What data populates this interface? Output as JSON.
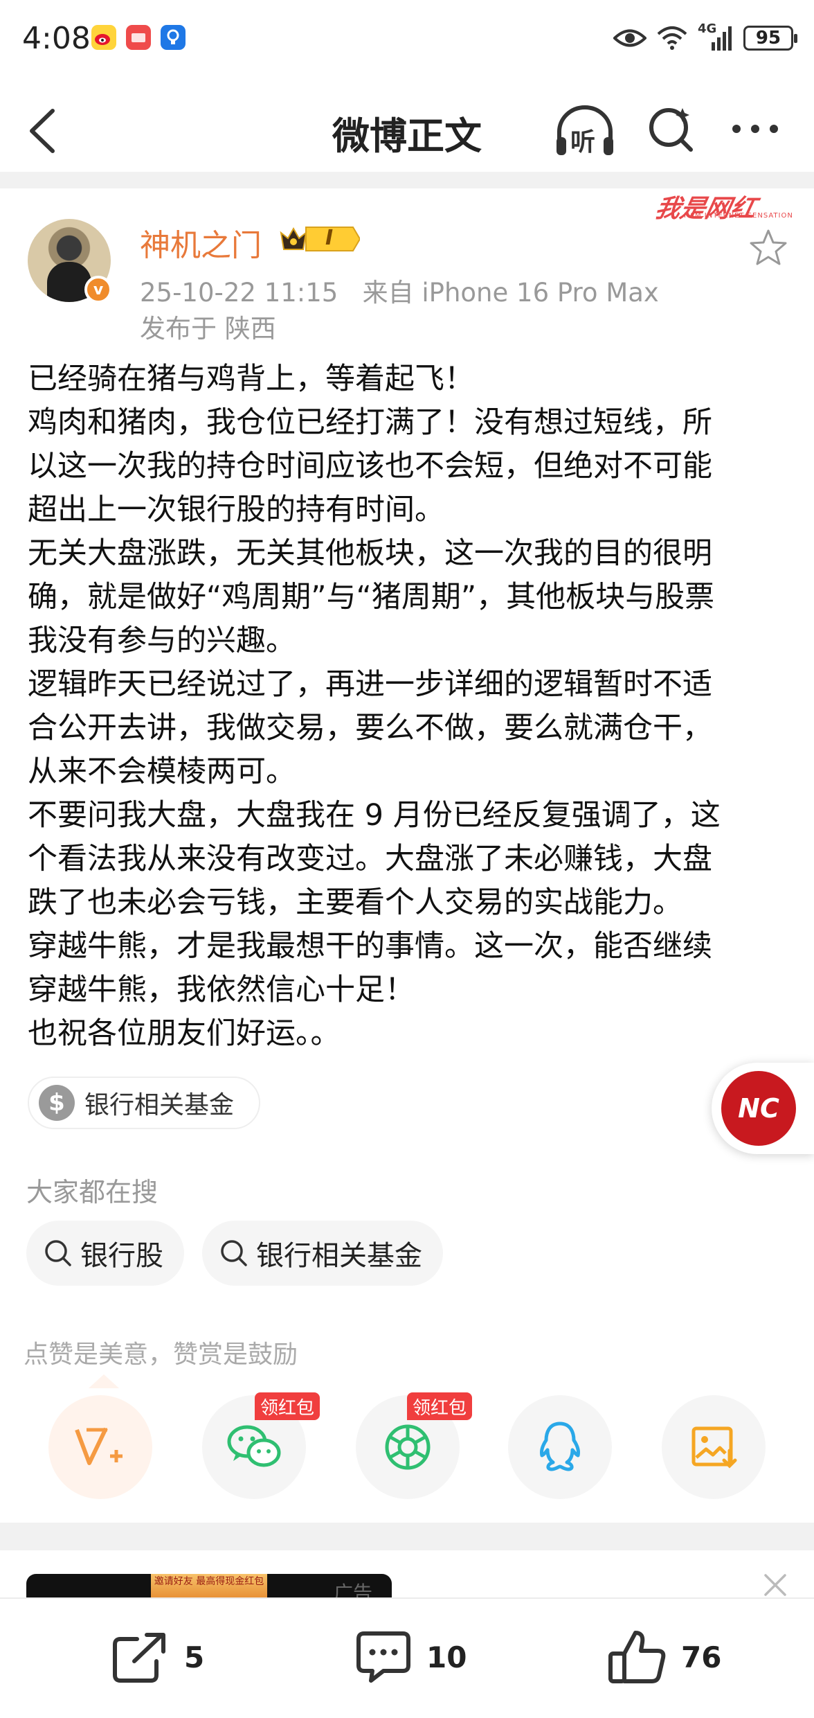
{
  "status_bar": {
    "time": "4:08",
    "network": "4G",
    "battery": "95",
    "icons": [
      "weibo-app-icon",
      "huawei-app-icon",
      "lightbulb-app-icon",
      "eye-icon",
      "wifi-icon",
      "signal-icon",
      "battery-icon"
    ]
  },
  "nav": {
    "title": "微博正文",
    "listen_label": "听",
    "icons": [
      "back-icon",
      "listen-icon",
      "search-icon",
      "more-icon"
    ]
  },
  "post": {
    "author": "神机之门",
    "vip_level": "I",
    "avatar_badge": "v",
    "meta": "25-10-22 11:15   来自 iPhone 16 Pro Max",
    "location": "发布于 陕西",
    "watermark": "我是网红",
    "watermark_sub": "I AM INTERNET SENSATION",
    "lines": [
      "已经骑在猪与鸡背上，等着起飞！",
      "鸡肉和猪肉，我仓位已经打满了！没有想过短线，所",
      "以这一次我的持仓时间应该也不会短，但绝对不可能",
      "超出上一次银行股的持有时间。",
      "无关大盘涨跌，无关其他板块，这一次我的目的很明",
      "确，就是做好“鸡周期”与“猪周期”，其他板块与股票",
      "我没有参与的兴趣。",
      "逻辑昨天已经说过了，再进一步详细的逻辑暂时不适",
      "合公开去讲，我做交易，要么不做，要么就满仓干，",
      "从来不会模棱两可。",
      "不要问我大盘，大盘我在 9 月份已经反复强调了，这",
      "个看法我从来没有改变过。大盘涨了未必赚钱，大盘",
      "跌了也未必会亏钱，主要看个人交易的实战能力。",
      "穿越牛熊，才是我最想干的事情。这一次，能否继续",
      "穿越牛熊，我依然信心十足！",
      "也祝各位朋友们好运。。"
    ],
    "topic_chip": "银行相关基金",
    "topic_icon": "$"
  },
  "floating_logo": {
    "text": "NC"
  },
  "search": {
    "header": "大家都在搜",
    "chips": [
      "银行股",
      "银行相关基金"
    ]
  },
  "reward": {
    "text": "点赞是美意，赞赏是鼓励",
    "share_targets": [
      "weibo-reward",
      "wechat",
      "moments",
      "qq",
      "save-image"
    ],
    "red_tag": "领红包"
  },
  "ad": {
    "label": "广告",
    "banner_text": "邀请好友 最高得现金红包"
  },
  "bottom_bar": {
    "repost_count": "5",
    "comment_count": "10",
    "like_count": "76"
  },
  "colors": {
    "accent_orange": "#e8793a",
    "red": "#f03e3e",
    "wechat_green": "#2fbf71",
    "qq_blue": "#2aa8e8",
    "reward_orange": "#f59a42"
  }
}
